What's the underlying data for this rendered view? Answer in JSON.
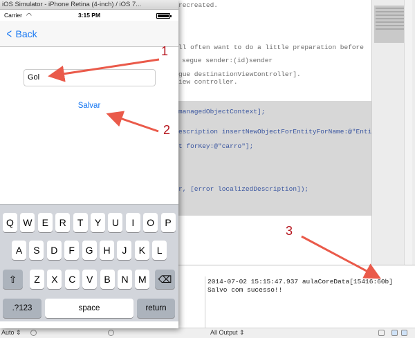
{
  "simulator": {
    "window_title": "iOS Simulator - iPhone Retina (4-inch) / iOS 7...",
    "status": {
      "carrier": "Carrier",
      "time": "3:15 PM"
    },
    "nav": {
      "back_label": "Back"
    },
    "form": {
      "text_value": "Gol",
      "save_label": "Salvar"
    },
    "keyboard": {
      "row1": [
        "Q",
        "W",
        "E",
        "R",
        "T",
        "Y",
        "U",
        "I",
        "O",
        "P"
      ],
      "row2": [
        "A",
        "S",
        "D",
        "F",
        "G",
        "H",
        "J",
        "K",
        "L"
      ],
      "row3": [
        "Z",
        "X",
        "C",
        "V",
        "B",
        "N",
        "M"
      ],
      "numbers_label": ".?123",
      "space_label": "space",
      "return_label": "return"
    }
  },
  "xcode": {
    "code_fragments": [
      "recreated.",
      "ll often want to do a little preparation before",
      "segue sender:(id)sender",
      "gue destinationViewController].",
      "iew controller.",
      "managedObjectContext];",
      "escription insertNewObjectForEntityForName:@\"Entity\"",
      "t forKey:@\"carro\"];",
      "r, [error localizedDescription]);"
    ],
    "console_log": "2014-07-02 15:15:47.937 aulaCoreData[15416:60b] Salvo com sucesso!!",
    "bottom_bar": {
      "auto_label": "Auto ⇕",
      "output_label": "All Output ⇕"
    }
  },
  "annotations": {
    "labels": [
      "1",
      "2",
      "3"
    ],
    "arrow_color": "#ea5a4a"
  },
  "colors": {
    "ios_blue": "#1476f2",
    "keyboard_bg": "#d2d5db"
  }
}
